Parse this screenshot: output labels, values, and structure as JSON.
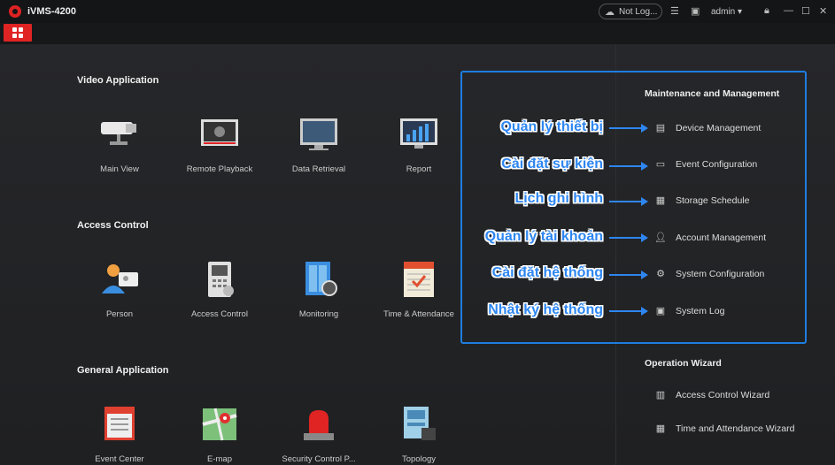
{
  "app": {
    "title": "iVMS-4200"
  },
  "titlebar": {
    "cloud_label": "Not Log...",
    "user": "admin"
  },
  "sections": {
    "video": {
      "title": "Video Application",
      "items": [
        {
          "label": "Main View",
          "icon": "camera-icon"
        },
        {
          "label": "Remote Playback",
          "icon": "playback-icon"
        },
        {
          "label": "Data Retrieval",
          "icon": "monitor-icon"
        },
        {
          "label": "Report",
          "icon": "report-chart-icon"
        }
      ]
    },
    "access": {
      "title": "Access Control",
      "items": [
        {
          "label": "Person",
          "icon": "person-card-icon"
        },
        {
          "label": "Access Control",
          "icon": "door-panel-icon"
        },
        {
          "label": "Monitoring",
          "icon": "monitoring-door-icon"
        },
        {
          "label": "Time & Attendance",
          "icon": "calendar-icon"
        }
      ]
    },
    "general": {
      "title": "General Application",
      "items": [
        {
          "label": "Event Center",
          "icon": "event-center-icon"
        },
        {
          "label": "E-map",
          "icon": "map-icon"
        },
        {
          "label": "Security Control P...",
          "icon": "alarm-light-icon"
        },
        {
          "label": "Topology",
          "icon": "topology-icon"
        }
      ]
    }
  },
  "maintenance": {
    "title": "Maintenance and Management",
    "items": [
      {
        "label": "Device Management",
        "icon": "device-icon"
      },
      {
        "label": "Event Configuration",
        "icon": "event-config-icon"
      },
      {
        "label": "Storage Schedule",
        "icon": "storage-icon"
      },
      {
        "label": "Account Management",
        "icon": "user-icon"
      },
      {
        "label": "System Configuration",
        "icon": "gear-icon"
      },
      {
        "label": "System Log",
        "icon": "log-icon"
      }
    ]
  },
  "wizard": {
    "title": "Operation Wizard",
    "items": [
      {
        "label": "Access Control Wizard",
        "icon": "access-wizard-icon"
      },
      {
        "label": "Time and Attendance Wizard",
        "icon": "attendance-wizard-icon"
      }
    ]
  },
  "annotations": [
    "Quản lý thiết bị",
    "Cài đặt sự kiện",
    "Lịch ghi hình",
    "Quản lý tài khoản",
    "Cài đặt hệ thống",
    "Nhật ký hệ thống"
  ],
  "colors": {
    "accent_red": "#e02424",
    "highlight_blue": "#1e7de0",
    "annotation_blue": "#2e86f0"
  }
}
